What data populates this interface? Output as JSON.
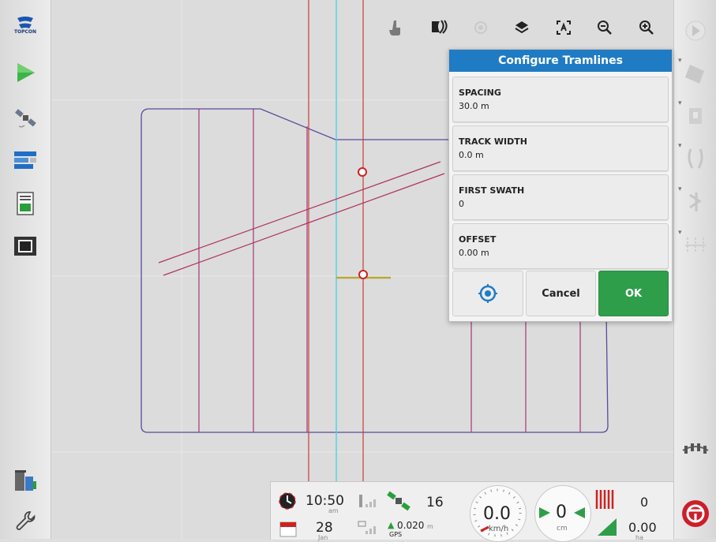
{
  "brand": {
    "logo_text": "TOPCON"
  },
  "left_toolbar": {
    "items": [
      {
        "name": "topcon-logo",
        "icon": "topcon-logo-icon"
      },
      {
        "name": "run-screen",
        "icon": "play-arrow-icon"
      },
      {
        "name": "gps",
        "icon": "satellite-icon"
      },
      {
        "name": "implement",
        "icon": "implement-bars-icon"
      },
      {
        "name": "report",
        "icon": "document-icon"
      },
      {
        "name": "video",
        "icon": "film-icon"
      },
      {
        "name": "diagnostics",
        "icon": "bins-icon"
      },
      {
        "name": "settings",
        "icon": "wrench-icon"
      }
    ]
  },
  "map_tools": [
    "hand-icon",
    "swath-icon",
    "target-icon",
    "layers-icon",
    "extent-icon",
    "zoom-out-icon",
    "zoom-in-icon"
  ],
  "dialog": {
    "title": "Configure Tramlines",
    "fields": [
      {
        "label": "SPACING",
        "value": "30.0 m"
      },
      {
        "label": "TRACK WIDTH",
        "value": "0.0 m"
      },
      {
        "label": "FIRST SWATH",
        "value": "0"
      },
      {
        "label": "OFFSET",
        "value": "0.00 m"
      }
    ],
    "cancel_label": "Cancel",
    "ok_label": "OK"
  },
  "status_bar": {
    "time": "10:50",
    "time_suffix": "am",
    "date_day": "28",
    "date_month": "Jan",
    "satellites": "16",
    "accuracy": "0.020",
    "accuracy_unit": "m",
    "gps_label": "GPS",
    "speed": "0.0",
    "speed_unit": "km/h",
    "cross_track": "0",
    "cross_track_unit": "cm",
    "sections_count": "0",
    "area": "0.00",
    "area_unit": "ha"
  },
  "colors": {
    "accent": "#1f7bc4",
    "ok": "#2e9e4a",
    "boundary": "#5b4a9a",
    "tramline": "#a23a6e",
    "guideline": "#cc3b3b",
    "cyan": "#49d3e0"
  }
}
